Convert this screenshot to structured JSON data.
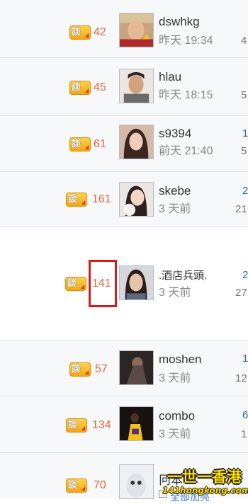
{
  "colors": {
    "count_orange": "#e06a3f",
    "highlight_red": "#d71b1b",
    "row_bg": "#f7f8fa",
    "link_blue": "#2a6aa8",
    "watermark_yellow": "#ffdd00"
  },
  "badge_icon": "discussion-badge-icon",
  "rows": [
    {
      "count": "42",
      "name": "dswhkg",
      "time": "昨天 19:34",
      "col1": "",
      "col2": "4"
    },
    {
      "count": "45",
      "name": "hlau",
      "time": "昨天 18:15",
      "col1": "",
      "col2": "5"
    },
    {
      "count": "61",
      "name": "s9394",
      "time": "前天 21:40",
      "col1": "1",
      "col2": "5"
    },
    {
      "count": "161",
      "name": "skebe",
      "time": "3 天前",
      "col1": "2",
      "col2": "21"
    },
    {
      "count": "141",
      "name": ".酒店兵頭.",
      "time": "3 天前",
      "col1": "2",
      "col2": "27"
    },
    {
      "count": "57",
      "name": "moshen",
      "time": "3 天前",
      "col1": "1",
      "col2": "12"
    },
    {
      "count": "134",
      "name": "combo",
      "time": "3 天前",
      "col1": "6",
      "col2": "1"
    },
    {
      "count": "70",
      "name": "冋本",
      "time": "",
      "col1": "",
      "col2": ""
    }
  ],
  "footer": {
    "label": "全部加亮"
  },
  "watermark": {
    "line1": "一世一香港",
    "line2": "141hongkong.com"
  }
}
